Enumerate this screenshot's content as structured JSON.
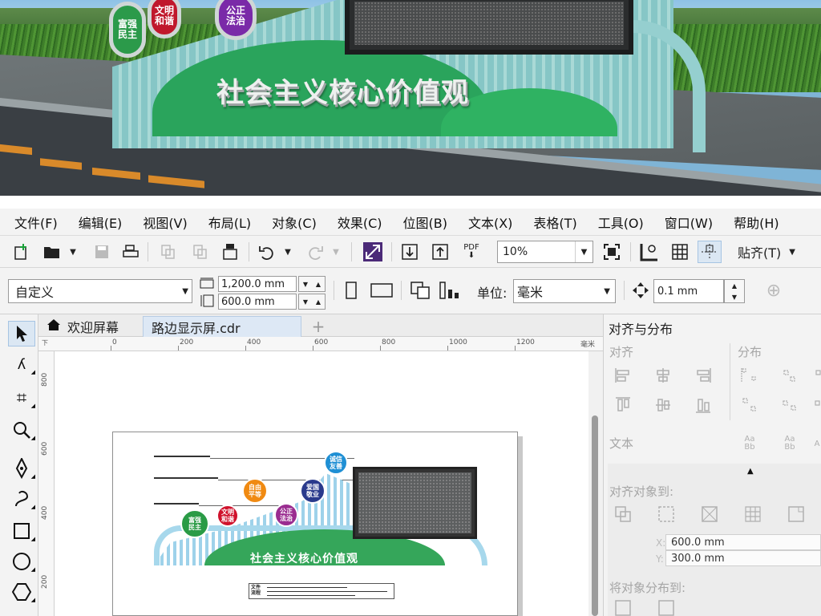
{
  "photo": {
    "circles": [
      {
        "text": "富强\n民主",
        "color": "#2b9a4a"
      },
      {
        "text": "文明\n和谐",
        "color": "#c0182c"
      },
      {
        "text": "公正\n法治",
        "color": "#7a2aa8"
      }
    ],
    "slogan": "社会主义核心价值观"
  },
  "menubar": {
    "items": [
      "文件(F)",
      "编辑(E)",
      "视图(V)",
      "布局(L)",
      "对象(C)",
      "效果(C)",
      "位图(B)",
      "文本(X)",
      "表格(T)",
      "工具(O)",
      "窗口(W)",
      "帮助(H)"
    ]
  },
  "toolbar": {
    "zoom": "10%",
    "snap": "贴齐(T)",
    "icons": [
      "new-doc-icon",
      "open-folder-icon",
      "save-icon",
      "print-icon",
      "import-icon",
      "export-icon",
      "publish-pdf-icon",
      "undo-icon",
      "redo-icon",
      "app-launcher-icon",
      "import-arrow-icon",
      "export-arrow-icon",
      "pdf-icon",
      "full-screen-icon",
      "rulers-icon",
      "grid-icon",
      "guidelines-icon"
    ]
  },
  "propbar": {
    "preset": "自定义",
    "width": "1,200.0 mm",
    "height": "600.0 mm",
    "unit_label": "单位:",
    "unit": "毫米",
    "nudge": "0.1 mm"
  },
  "tabs": {
    "home": "欢迎屏幕",
    "active": "路边显示屏.cdr",
    "plus": "+"
  },
  "ruler": {
    "h_ticks": [
      "0",
      "200",
      "400",
      "600",
      "800",
      "1000",
      "1200"
    ],
    "h_unit": "毫米",
    "v_ticks": [
      "800",
      "600",
      "400",
      "200"
    ],
    "corner": "下"
  },
  "design": {
    "circles": [
      {
        "text": "诚信\n友善",
        "color": "#1f8fd4"
      },
      {
        "text": "自由\n平等",
        "color": "#f08a12"
      },
      {
        "text": "爱国\n敬业",
        "color": "#2a3a8c"
      },
      {
        "text": "公正\n法治",
        "color": "#9a2c90"
      },
      {
        "text": "文明\n和谐",
        "color": "#d0122c"
      },
      {
        "text": "富强\n民主",
        "color": "#2a9b46"
      }
    ],
    "slogan": "社会主义核心价值观",
    "label_title": "文件\n流程"
  },
  "docker": {
    "title": "对齐与分布",
    "align": "对齐",
    "distribute": "分布",
    "text": "文本",
    "align_to": "对齐对象到:",
    "x_label": "X:",
    "x_value": "600.0 mm",
    "y_label": "Y:",
    "y_value": "300.0 mm",
    "distribute_to": "将对象分布到:"
  }
}
